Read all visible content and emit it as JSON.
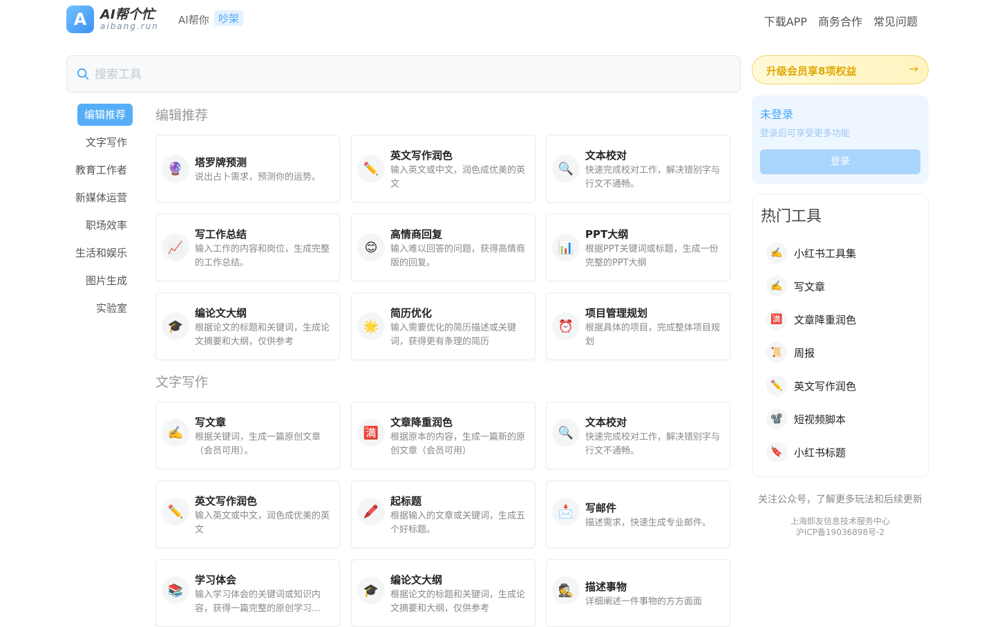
{
  "header": {
    "logo_mark": "A",
    "logo_title": "AI帮个忙",
    "logo_sub": "aibang.run",
    "slogan": "AI帮你",
    "slogan_tag": "吵架",
    "nav": [
      "下载APP",
      "商务合作",
      "常见问题"
    ]
  },
  "search": {
    "placeholder": "搜索工具"
  },
  "categories": [
    "编辑推荐",
    "文字写作",
    "教育工作者",
    "新媒体运营",
    "职场效率",
    "生活和娱乐",
    "图片生成",
    "实验室"
  ],
  "sections": [
    {
      "title": "编辑推荐",
      "cards": [
        {
          "icon": "crystal-ball-icon",
          "glyph": "🔮",
          "title": "塔罗牌预测",
          "desc": "说出占卜需求，预测你的运势。"
        },
        {
          "icon": "pencil-icon",
          "glyph": "✏️",
          "title": "英文写作润色",
          "desc": "输入英文或中文，润色成优美的英文"
        },
        {
          "icon": "magnifier-icon",
          "glyph": "🔍",
          "title": "文本校对",
          "desc": "快速完成校对工作，解决错别字与行文不通畅。"
        },
        {
          "icon": "chart-up-icon",
          "glyph": "📈",
          "title": "写工作总结",
          "desc": "输入工作的内容和岗位，生成完整的工作总结。"
        },
        {
          "icon": "smile-face-icon",
          "glyph": "😊",
          "title": "高情商回复",
          "desc": "输入难以回答的问题，获得高情商版的回复。"
        },
        {
          "icon": "bar-chart-icon",
          "glyph": "📊",
          "title": "PPT大纲",
          "desc": "根据PPT关键词或标题，生成一份完整的PPT大纲"
        },
        {
          "icon": "graduation-cap-icon",
          "glyph": "🎓",
          "title": "编论文大纲",
          "desc": "根据论文的标题和关键词，生成论文摘要和大纲，仅供参考"
        },
        {
          "icon": "sparkle-icon",
          "glyph": "🌟",
          "title": "简历优化",
          "desc": "输入需要优化的简历描述或关键词，获得更有条理的简历"
        },
        {
          "icon": "alarm-clock-icon",
          "glyph": "⏰",
          "title": "项目管理规划",
          "desc": "根据具体的项目，完成整体项目规划"
        }
      ]
    },
    {
      "title": "文字写作",
      "cards": [
        {
          "icon": "writing-hand-icon",
          "glyph": "✍️",
          "title": "写文章",
          "desc": "根据关键词，生成一篇原创文章（会员可用）。"
        },
        {
          "icon": "full-mark-icon",
          "glyph": "🈵",
          "title": "文章降重润色",
          "desc": "根据原本的内容，生成一篇新的原创文章（会员可用）"
        },
        {
          "icon": "magnifier-icon",
          "glyph": "🔍",
          "title": "文本校对",
          "desc": "快速完成校对工作，解决错别字与行文不通畅。"
        },
        {
          "icon": "pencil-icon",
          "glyph": "✏️",
          "title": "英文写作润色",
          "desc": "输入英文或中文，润色成优美的英文"
        },
        {
          "icon": "pen-icon",
          "glyph": "🖍️",
          "title": "起标题",
          "desc": "根据输入的文章或关键词，生成五个好标题。"
        },
        {
          "icon": "envelope-icon",
          "glyph": "📩",
          "title": "写邮件",
          "desc": "描述需求，快速生成专业邮件。"
        },
        {
          "icon": "books-icon",
          "glyph": "📚",
          "title": "学习体会",
          "desc": "输入学习体会的关键词或知识内容，获得一篇完整的原创学习…"
        },
        {
          "icon": "graduation-cap-icon",
          "glyph": "🎓",
          "title": "编论文大纲",
          "desc": "根据论文的标题和关键词，生成论文摘要和大纲，仅供参考"
        },
        {
          "icon": "detective-icon",
          "glyph": "🕵️",
          "title": "描述事物",
          "desc": "详细阐述一件事物的方方面面"
        }
      ]
    }
  ],
  "upgrade": {
    "label": "升级会员享8项权益",
    "arrow": "→"
  },
  "login": {
    "title": "未登录",
    "subtitle": "登录后可享受更多功能",
    "button": "登录"
  },
  "hot": {
    "title": "热门工具",
    "items": [
      {
        "icon": "writing-hand-icon",
        "glyph": "✍️",
        "label": "小红书工具集"
      },
      {
        "icon": "writing-hand-icon",
        "glyph": "✍️",
        "label": "写文章"
      },
      {
        "icon": "full-mark-icon",
        "glyph": "🈵",
        "label": "文章降重润色"
      },
      {
        "icon": "scroll-icon",
        "glyph": "📜",
        "label": "周报"
      },
      {
        "icon": "pencil-icon",
        "glyph": "✏️",
        "label": "英文写作润色"
      },
      {
        "icon": "film-icon",
        "glyph": "📽️",
        "label": "短视频脚本"
      },
      {
        "icon": "bookmark-icon",
        "glyph": "🔖",
        "label": "小红书标题"
      }
    ]
  },
  "footer": {
    "follow": "关注公众号，了解更多玩法和后续更新",
    "company": "上海即友信息技术服务中心",
    "icp": "沪ICP备19036898号-2"
  }
}
